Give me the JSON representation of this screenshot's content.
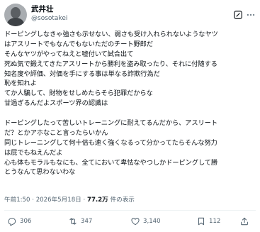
{
  "author": {
    "display_name": "武井壮",
    "handle": "@sosotakei"
  },
  "post_lines": [
    "ドーピングしなきゃ強さも示せない、弱さも受け入れられないようなヤツ",
    "はアスリートでもなんでもないただのチート野郎だ",
    "そんなヤツがやってねえと嘘付いて試合出て",
    "死ぬ気で鍛えてきたアスリートから勝利を盗み取ったり、それに付随する",
    "知名度や評価、対価を手にする事は単なる詐欺行為だ",
    "恥を知れよ",
    "てか人騙して、財物をせしめたらそら犯罪だからな",
    "甘過ぎるんだよスポーツ界の認識は",
    "",
    "ドーピングしたって苦しいトレーニングに耐えてるんだから、アスリート",
    "だ？とかアホなこと言ったらいかん",
    "同じトレーニングして何十倍も速く強くなるって分かってたらそんな努力",
    "は屁でもねえんだよ",
    "心も体もモラルもなにも、全てにおいて卑怯なやつしかドーピングして勝",
    "とうなんて思わないわな"
  ],
  "meta": {
    "time": "午前1:50",
    "separator": "·",
    "date": "2026年5月18日",
    "views_count": "77.2万",
    "views_label": "件の表示"
  },
  "actions": {
    "replies": "306",
    "reposts": "347",
    "likes": "3,140",
    "bookmarks": "112"
  },
  "colors": {
    "text": "#0f1419",
    "secondary": "#536471",
    "divider": "#eff3f4"
  }
}
